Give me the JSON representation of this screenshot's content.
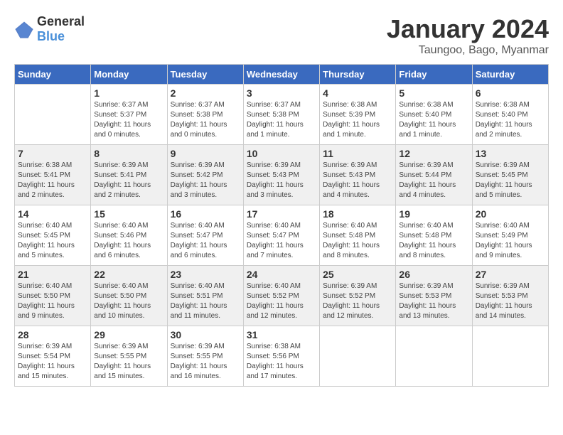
{
  "logo": {
    "text_general": "General",
    "text_blue": "Blue"
  },
  "title": "January 2024",
  "location": "Taungoo, Bago, Myanmar",
  "weekdays": [
    "Sunday",
    "Monday",
    "Tuesday",
    "Wednesday",
    "Thursday",
    "Friday",
    "Saturday"
  ],
  "weeks": [
    [
      {
        "day": "",
        "sunrise": "",
        "sunset": "",
        "daylight": ""
      },
      {
        "day": "1",
        "sunrise": "Sunrise: 6:37 AM",
        "sunset": "Sunset: 5:37 PM",
        "daylight": "Daylight: 11 hours and 0 minutes."
      },
      {
        "day": "2",
        "sunrise": "Sunrise: 6:37 AM",
        "sunset": "Sunset: 5:38 PM",
        "daylight": "Daylight: 11 hours and 0 minutes."
      },
      {
        "day": "3",
        "sunrise": "Sunrise: 6:37 AM",
        "sunset": "Sunset: 5:38 PM",
        "daylight": "Daylight: 11 hours and 1 minute."
      },
      {
        "day": "4",
        "sunrise": "Sunrise: 6:38 AM",
        "sunset": "Sunset: 5:39 PM",
        "daylight": "Daylight: 11 hours and 1 minute."
      },
      {
        "day": "5",
        "sunrise": "Sunrise: 6:38 AM",
        "sunset": "Sunset: 5:40 PM",
        "daylight": "Daylight: 11 hours and 1 minute."
      },
      {
        "day": "6",
        "sunrise": "Sunrise: 6:38 AM",
        "sunset": "Sunset: 5:40 PM",
        "daylight": "Daylight: 11 hours and 2 minutes."
      }
    ],
    [
      {
        "day": "7",
        "sunrise": "Sunrise: 6:38 AM",
        "sunset": "Sunset: 5:41 PM",
        "daylight": "Daylight: 11 hours and 2 minutes."
      },
      {
        "day": "8",
        "sunrise": "Sunrise: 6:39 AM",
        "sunset": "Sunset: 5:41 PM",
        "daylight": "Daylight: 11 hours and 2 minutes."
      },
      {
        "day": "9",
        "sunrise": "Sunrise: 6:39 AM",
        "sunset": "Sunset: 5:42 PM",
        "daylight": "Daylight: 11 hours and 3 minutes."
      },
      {
        "day": "10",
        "sunrise": "Sunrise: 6:39 AM",
        "sunset": "Sunset: 5:43 PM",
        "daylight": "Daylight: 11 hours and 3 minutes."
      },
      {
        "day": "11",
        "sunrise": "Sunrise: 6:39 AM",
        "sunset": "Sunset: 5:43 PM",
        "daylight": "Daylight: 11 hours and 4 minutes."
      },
      {
        "day": "12",
        "sunrise": "Sunrise: 6:39 AM",
        "sunset": "Sunset: 5:44 PM",
        "daylight": "Daylight: 11 hours and 4 minutes."
      },
      {
        "day": "13",
        "sunrise": "Sunrise: 6:39 AM",
        "sunset": "Sunset: 5:45 PM",
        "daylight": "Daylight: 11 hours and 5 minutes."
      }
    ],
    [
      {
        "day": "14",
        "sunrise": "Sunrise: 6:40 AM",
        "sunset": "Sunset: 5:45 PM",
        "daylight": "Daylight: 11 hours and 5 minutes."
      },
      {
        "day": "15",
        "sunrise": "Sunrise: 6:40 AM",
        "sunset": "Sunset: 5:46 PM",
        "daylight": "Daylight: 11 hours and 6 minutes."
      },
      {
        "day": "16",
        "sunrise": "Sunrise: 6:40 AM",
        "sunset": "Sunset: 5:47 PM",
        "daylight": "Daylight: 11 hours and 6 minutes."
      },
      {
        "day": "17",
        "sunrise": "Sunrise: 6:40 AM",
        "sunset": "Sunset: 5:47 PM",
        "daylight": "Daylight: 11 hours and 7 minutes."
      },
      {
        "day": "18",
        "sunrise": "Sunrise: 6:40 AM",
        "sunset": "Sunset: 5:48 PM",
        "daylight": "Daylight: 11 hours and 8 minutes."
      },
      {
        "day": "19",
        "sunrise": "Sunrise: 6:40 AM",
        "sunset": "Sunset: 5:48 PM",
        "daylight": "Daylight: 11 hours and 8 minutes."
      },
      {
        "day": "20",
        "sunrise": "Sunrise: 6:40 AM",
        "sunset": "Sunset: 5:49 PM",
        "daylight": "Daylight: 11 hours and 9 minutes."
      }
    ],
    [
      {
        "day": "21",
        "sunrise": "Sunrise: 6:40 AM",
        "sunset": "Sunset: 5:50 PM",
        "daylight": "Daylight: 11 hours and 9 minutes."
      },
      {
        "day": "22",
        "sunrise": "Sunrise: 6:40 AM",
        "sunset": "Sunset: 5:50 PM",
        "daylight": "Daylight: 11 hours and 10 minutes."
      },
      {
        "day": "23",
        "sunrise": "Sunrise: 6:40 AM",
        "sunset": "Sunset: 5:51 PM",
        "daylight": "Daylight: 11 hours and 11 minutes."
      },
      {
        "day": "24",
        "sunrise": "Sunrise: 6:40 AM",
        "sunset": "Sunset: 5:52 PM",
        "daylight": "Daylight: 11 hours and 12 minutes."
      },
      {
        "day": "25",
        "sunrise": "Sunrise: 6:39 AM",
        "sunset": "Sunset: 5:52 PM",
        "daylight": "Daylight: 11 hours and 12 minutes."
      },
      {
        "day": "26",
        "sunrise": "Sunrise: 6:39 AM",
        "sunset": "Sunset: 5:53 PM",
        "daylight": "Daylight: 11 hours and 13 minutes."
      },
      {
        "day": "27",
        "sunrise": "Sunrise: 6:39 AM",
        "sunset": "Sunset: 5:53 PM",
        "daylight": "Daylight: 11 hours and 14 minutes."
      }
    ],
    [
      {
        "day": "28",
        "sunrise": "Sunrise: 6:39 AM",
        "sunset": "Sunset: 5:54 PM",
        "daylight": "Daylight: 11 hours and 15 minutes."
      },
      {
        "day": "29",
        "sunrise": "Sunrise: 6:39 AM",
        "sunset": "Sunset: 5:55 PM",
        "daylight": "Daylight: 11 hours and 15 minutes."
      },
      {
        "day": "30",
        "sunrise": "Sunrise: 6:39 AM",
        "sunset": "Sunset: 5:55 PM",
        "daylight": "Daylight: 11 hours and 16 minutes."
      },
      {
        "day": "31",
        "sunrise": "Sunrise: 6:38 AM",
        "sunset": "Sunset: 5:56 PM",
        "daylight": "Daylight: 11 hours and 17 minutes."
      },
      {
        "day": "",
        "sunrise": "",
        "sunset": "",
        "daylight": ""
      },
      {
        "day": "",
        "sunrise": "",
        "sunset": "",
        "daylight": ""
      },
      {
        "day": "",
        "sunrise": "",
        "sunset": "",
        "daylight": ""
      }
    ]
  ]
}
